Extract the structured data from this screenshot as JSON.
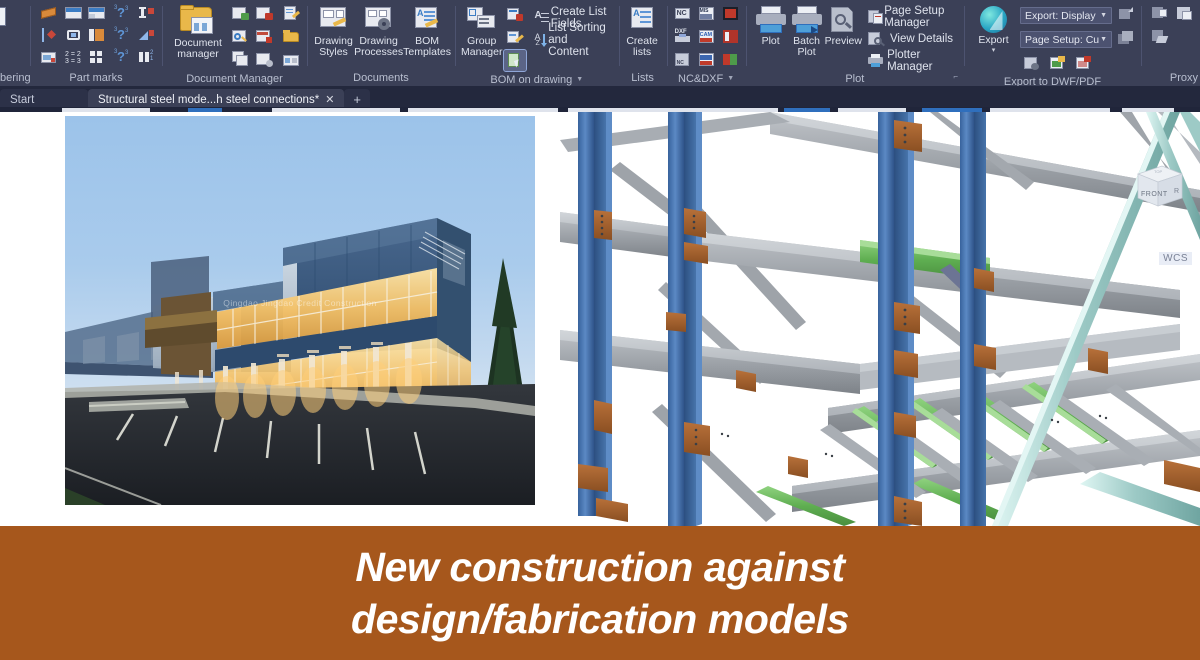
{
  "app": {
    "ribbon_bg": "#3b4057",
    "banner_bg": "#a6571c",
    "accent_blue": "#2f6fbd"
  },
  "ribbon": {
    "panels": [
      {
        "name": "numbering",
        "label": "bering",
        "truncated": true,
        "buttons": [
          {
            "label": "",
            "icon": "numbering-000-icon"
          }
        ]
      },
      {
        "name": "part-marks",
        "label": "Part marks",
        "icons": [
          "part-mark-icon",
          "part-mark-table-icon",
          "part-mark-table2-icon",
          "part-mark-question-1-icon",
          "part-mark-beam-icon",
          "dimension-mark-icon",
          "bolt-mark-icon",
          "plate-mark-icon",
          "part-mark-question-2-icon",
          "part-mark-section-icon",
          "image-mark-icon",
          "equal-marks-icon",
          "grid-marks-icon",
          "part-mark-question-3-icon",
          "assembly-mark-icon"
        ]
      },
      {
        "name": "document-manager",
        "label": "Document Manager",
        "big": {
          "label_line1": "Document",
          "label_line2": "manager",
          "icon": "document-manager-icon"
        },
        "icons": [
          "doc-add-icon",
          "doc-remove-icon",
          "doc-edit-icon",
          "doc-search-icon",
          "doc-delete-icon",
          "doc-open-folder-icon",
          "doc-copy-icon",
          "doc-settings-icon",
          "doc-export-icon"
        ]
      },
      {
        "name": "documents",
        "label": "Documents",
        "buttons": [
          {
            "label_line1": "Drawing",
            "label_line2": "Styles",
            "icon": "drawing-styles-icon"
          },
          {
            "label_line1": "Drawing",
            "label_line2": "Processes",
            "icon": "drawing-processes-icon"
          },
          {
            "label_line1": "BOM",
            "label_line2": "Templates",
            "icon": "bom-templates-icon"
          }
        ]
      },
      {
        "name": "bom-on-drawing",
        "label": "BOM on drawing",
        "has_dropdown": true,
        "buttons": [
          {
            "label_line1": "Group",
            "label_line2": "Manager",
            "icon": "group-manager-icon"
          }
        ],
        "small_icons": [
          "bom-insert-icon",
          "bom-edit-icon",
          "bom-select-icon"
        ],
        "rows": [
          {
            "label": "Create List Fields",
            "icon": "create-list-fields-icon"
          },
          {
            "label": "List Sorting and Content",
            "icon": "list-sorting-icon"
          }
        ]
      },
      {
        "name": "lists",
        "label": "Lists",
        "buttons": [
          {
            "label_line1": "Create",
            "label_line2": "lists",
            "icon": "create-lists-icon"
          }
        ]
      },
      {
        "name": "nc-dxf",
        "label": "NC&DXF",
        "has_dropdown": true,
        "icons": [
          "nc-icon",
          "mis-icon",
          "steel-red-icon",
          "dxf-icon",
          "cam-icon",
          "structure-red-icon",
          "nc-db-icon",
          "sdnf-icon",
          "books-icon"
        ]
      },
      {
        "name": "plot",
        "label": "Plot",
        "has_dialog_launcher": true,
        "buttons": [
          {
            "label_line1": "Plot",
            "label_line2": "",
            "icon": "plot-icon"
          },
          {
            "label_line1": "Batch",
            "label_line2": "Plot",
            "icon": "batch-plot-icon"
          },
          {
            "label_line1": "Preview",
            "label_line2": "",
            "icon": "plot-preview-icon"
          }
        ],
        "rows": [
          {
            "label": "Page Setup Manager",
            "icon": "page-setup-manager-icon"
          },
          {
            "label": "View Details",
            "icon": "view-details-icon"
          },
          {
            "label": "Plotter Manager",
            "icon": "plotter-manager-icon"
          }
        ]
      },
      {
        "name": "export-to-dwf-pdf",
        "label": "Export to DWF/PDF",
        "buttons": [
          {
            "label_line1": "Export",
            "label_line2": "",
            "icon": "export-icon",
            "has_menu_arrow": true
          }
        ],
        "combos": [
          {
            "name": "export-display-combo",
            "value": "Export: Display"
          },
          {
            "name": "page-setup-combo",
            "value": "Page Setup: Cu"
          }
        ],
        "small_icons": [
          "export-page-icon",
          "export-dwf-icon",
          "export-pdf-icon",
          "export-stack-icon",
          "export-layers-icon"
        ]
      },
      {
        "name": "proxy",
        "label": "Proxy",
        "icons": [
          "proxy-object-icon",
          "proxy-explode-icon",
          "proxy-extra-icon"
        ]
      }
    ]
  },
  "tabs": {
    "items": [
      {
        "name": "tab-start",
        "label": "Start",
        "active": false,
        "closable": false
      },
      {
        "name": "tab-drawing",
        "label": "Structural steel mode...h steel connections*",
        "active": true,
        "closable": true,
        "close_glyph": "✕"
      }
    ],
    "new_tab_glyph": "+"
  },
  "canvas": {
    "photo": {
      "name": "building-photo",
      "alt": "Modern two-story office building at dusk with illuminated glass facade and parking lot",
      "watermark": "Qingdao Jingdao Credit Construction"
    },
    "model": {
      "name": "steel-structure-3d-model",
      "viewcube_faces": {
        "front": "FRONT",
        "right": "R"
      },
      "wcs_label": "WCS",
      "colors": {
        "column": "#4a79b4",
        "beam": "#9ea3a8",
        "joist": "#6cb361",
        "brace": "#9ec9c6",
        "plate": "#9c5a2a"
      }
    }
  },
  "banner": {
    "line1": "New construction against",
    "line2": "design/fabrication models"
  }
}
